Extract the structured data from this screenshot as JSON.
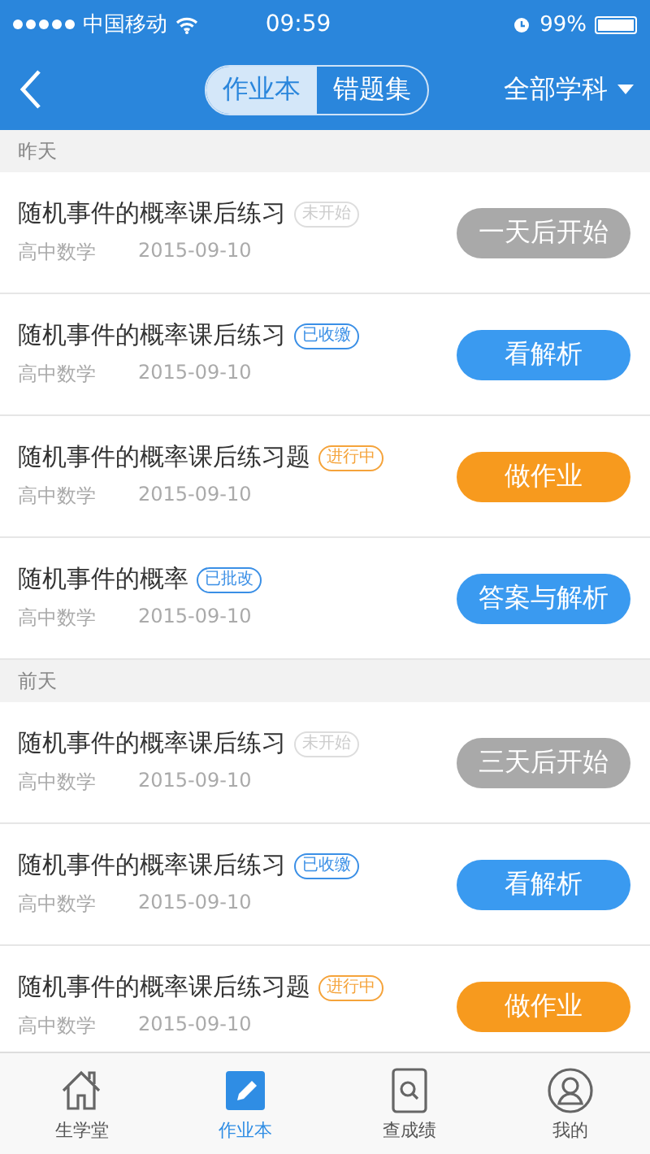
{
  "status_bar": {
    "carrier": "中国移动",
    "time": "09:59",
    "battery": "99%"
  },
  "header": {
    "segments": [
      {
        "label": "作业本",
        "selected": true
      },
      {
        "label": "错题集",
        "selected": false
      }
    ],
    "filter": "全部学科"
  },
  "sections": [
    {
      "title": "昨天",
      "items": [
        {
          "title": "随机事件的概率课后练习",
          "tag": {
            "label": "未开始",
            "kind": "grey"
          },
          "subject": "高中数学",
          "date": "2015-09-10",
          "action": {
            "label": "一天后开始",
            "kind": "disabled"
          }
        },
        {
          "title": "随机事件的概率课后练习",
          "tag": {
            "label": "已收缴",
            "kind": "blue"
          },
          "subject": "高中数学",
          "date": "2015-09-10",
          "action": {
            "label": "看解析",
            "kind": "blue"
          }
        },
        {
          "title": "随机事件的概率课后练习题",
          "tag": {
            "label": "进行中",
            "kind": "orange"
          },
          "subject": "高中数学",
          "date": "2015-09-10",
          "action": {
            "label": "做作业",
            "kind": "orange"
          }
        },
        {
          "title": "随机事件的概率",
          "tag": {
            "label": "已批改",
            "kind": "blue"
          },
          "subject": "高中数学",
          "date": "2015-09-10",
          "action": {
            "label": "答案与解析",
            "kind": "blue"
          }
        }
      ]
    },
    {
      "title": "前天",
      "items": [
        {
          "title": "随机事件的概率课后练习",
          "tag": {
            "label": "未开始",
            "kind": "grey"
          },
          "subject": "高中数学",
          "date": "2015-09-10",
          "action": {
            "label": "三天后开始",
            "kind": "disabled"
          }
        },
        {
          "title": "随机事件的概率课后练习",
          "tag": {
            "label": "已收缴",
            "kind": "blue"
          },
          "subject": "高中数学",
          "date": "2015-09-10",
          "action": {
            "label": "看解析",
            "kind": "blue"
          }
        },
        {
          "title": "随机事件的概率课后练习题",
          "tag": {
            "label": "进行中",
            "kind": "orange"
          },
          "subject": "高中数学",
          "date": "2015-09-10",
          "action": {
            "label": "做作业",
            "kind": "orange"
          }
        }
      ]
    }
  ],
  "tab_bar": [
    {
      "label": "生学堂",
      "kind": "home",
      "selected": false
    },
    {
      "label": "作业本",
      "kind": "edit",
      "selected": true
    },
    {
      "label": "查成绩",
      "kind": "search",
      "selected": false
    },
    {
      "label": "我的",
      "kind": "profile",
      "selected": false
    }
  ]
}
